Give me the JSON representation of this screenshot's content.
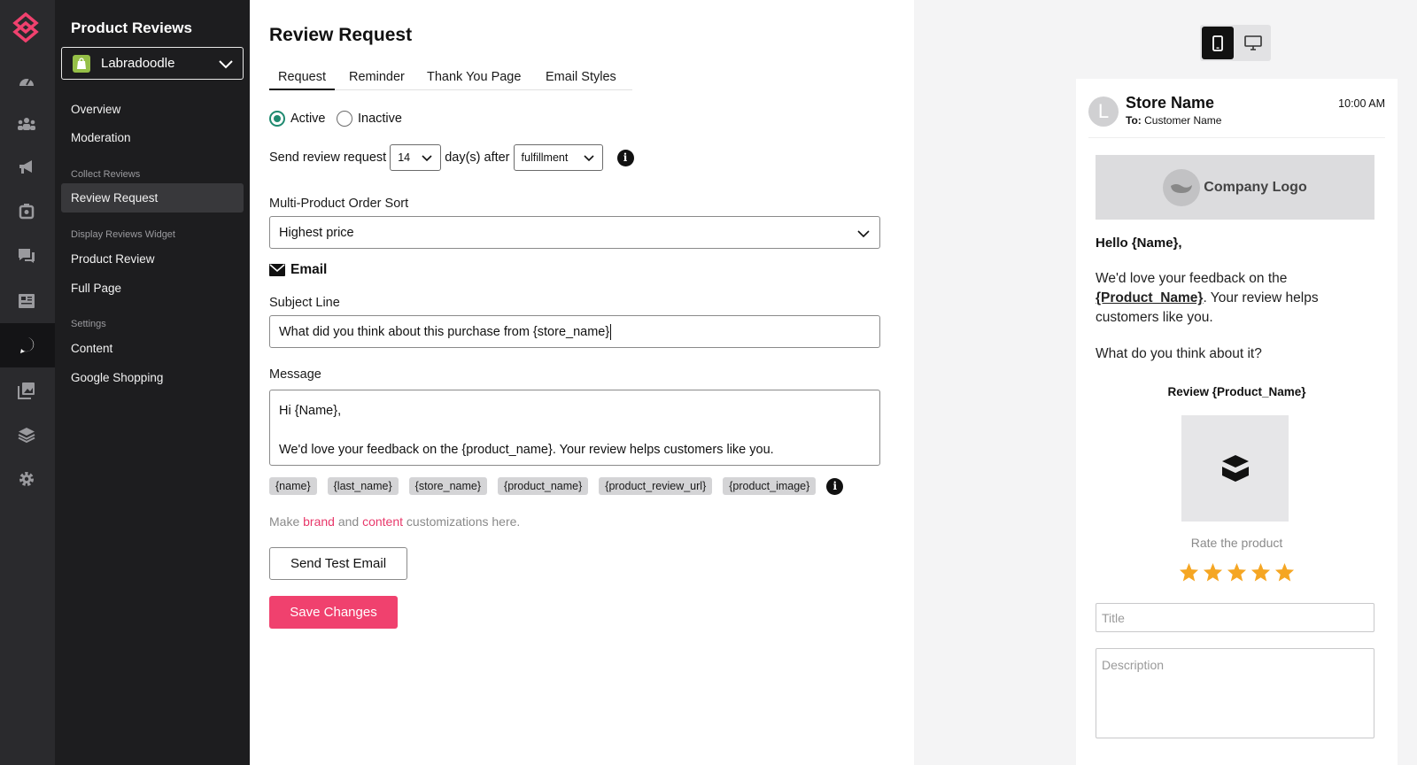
{
  "sidebar": {
    "title": "Product Reviews",
    "store": "Labradoodle",
    "items": [
      {
        "label": "Overview"
      },
      {
        "label": "Moderation"
      }
    ],
    "group_collect": "Collect Reviews",
    "collect_items": [
      {
        "label": "Review Request"
      }
    ],
    "group_display": "Display Reviews Widget",
    "display_items": [
      {
        "label": "Product Review"
      },
      {
        "label": "Full Page"
      }
    ],
    "group_settings": "Settings",
    "settings_items": [
      {
        "label": "Content"
      },
      {
        "label": "Google Shopping"
      }
    ],
    "rail_icons": [
      "dashboard-icon",
      "customers-icon",
      "megaphone-icon",
      "loyalty-icon",
      "chat-icon",
      "newsletter-icon",
      "reviews-icon",
      "gallery-icon",
      "layers-icon",
      "settings-icon"
    ]
  },
  "main": {
    "title": "Review Request",
    "tabs": [
      {
        "label": "Request"
      },
      {
        "label": "Reminder"
      },
      {
        "label": "Thank You Page"
      },
      {
        "label": "Email Styles"
      }
    ],
    "status": {
      "active_label": "Active",
      "inactive_label": "Inactive",
      "selected": "Active"
    },
    "send_row": {
      "prefix": "Send review request",
      "days": "14",
      "middle": "day(s) after",
      "trigger": "fulfillment"
    },
    "sort": {
      "label": "Multi-Product Order Sort",
      "value": "Highest price"
    },
    "email_heading": "Email",
    "subject": {
      "label": "Subject Line",
      "value": "What did you think about this purchase from {store_name}"
    },
    "message": {
      "label": "Message",
      "line1": "Hi {Name},",
      "line2": "We'd love your feedback on the {product_name}. Your review helps customers like you."
    },
    "variables": [
      "{name}",
      "{last_name}",
      "{store_name}",
      "{product_name}",
      "{product_review_url}",
      "{product_image}"
    ],
    "hint": {
      "make": "Make",
      "brand": "brand",
      "and": "and",
      "content": "content",
      "rest": "customizations here."
    },
    "test_button": "Send Test Email",
    "save_button": "Save Changes"
  },
  "preview": {
    "store_name": "Store Name",
    "avatar_letter": "L",
    "to_label": "To:",
    "to_value": "Customer Name",
    "time": "10:00 AM",
    "logo_text": "Company Logo",
    "greeting": "Hello {Name},",
    "body_pre": "We'd love your feedback on the",
    "body_product": "{Product_Name}",
    "body_post": ". Your review helps customers like you.",
    "question": "What do you think about it?",
    "review_title": "Review {Product_Name}",
    "rate_label": "Rate the product",
    "rating": 5,
    "title_placeholder": "Title",
    "description_placeholder": "Description",
    "colors": {
      "accent": "#f0416e",
      "star": "#f5a623",
      "active_radio": "#1f8a70"
    }
  }
}
